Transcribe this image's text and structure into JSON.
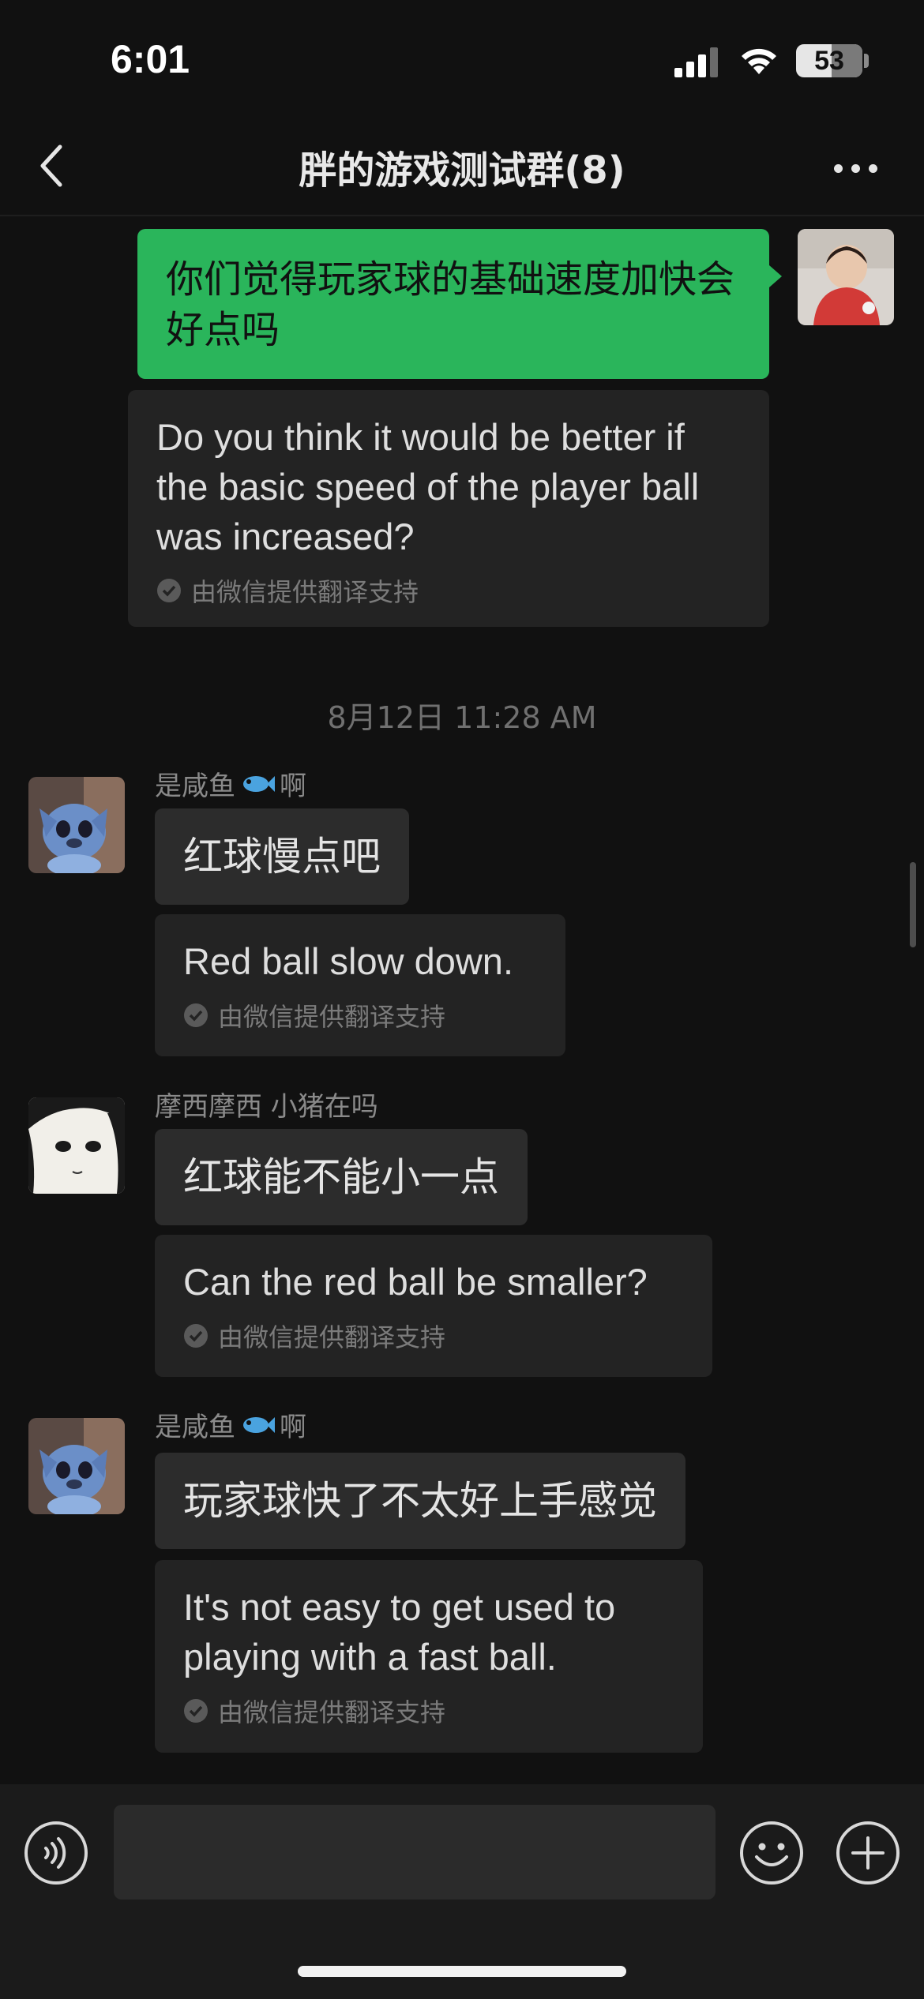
{
  "status_bar": {
    "time": "6:01",
    "battery": "53",
    "battery_level": 0.53
  },
  "nav": {
    "title": "胖的游戏测试群(8)",
    "back_icon": "chevron-left-icon",
    "more_icon": "ellipsis-icon"
  },
  "chat": {
    "my_message": {
      "text": "你们觉得玩家球的基础速度加快会好点吗",
      "translation": "Do you think it would be better if the basic speed of the player ball was increased?",
      "translation_credit": "由微信提供翻译支持"
    },
    "timestamp": "8月12日 11:28 AM",
    "messages": [
      {
        "sender_prefix": "是咸鱼",
        "sender_suffix": "啊",
        "sender_icon": "fish-emoji-icon",
        "text": "红球慢点吧",
        "translation": "Red ball slow down.",
        "translation_credit": "由微信提供翻译支持"
      },
      {
        "sender_prefix": "摩西摩西 小猪在吗",
        "text": "红球能不能小一点",
        "translation": "Can the red ball be smaller?",
        "translation_credit": "由微信提供翻译支持"
      },
      {
        "sender_prefix": "是咸鱼",
        "sender_suffix": "啊",
        "sender_icon": "fish-emoji-icon",
        "text": "玩家球快了不太好上手感觉",
        "translation": "It's not easy to get used to playing with a fast ball.",
        "translation_credit": "由微信提供翻译支持"
      }
    ]
  },
  "input_bar": {
    "voice_icon": "voice-icon",
    "input_value": "",
    "emoji_icon": "smiley-icon",
    "plus_icon": "plus-circle-icon"
  },
  "colors": {
    "background": "#111111",
    "my_bubble": "#2ab55b",
    "other_bubble": "#2c2c2c",
    "translation_box": "#232323"
  }
}
